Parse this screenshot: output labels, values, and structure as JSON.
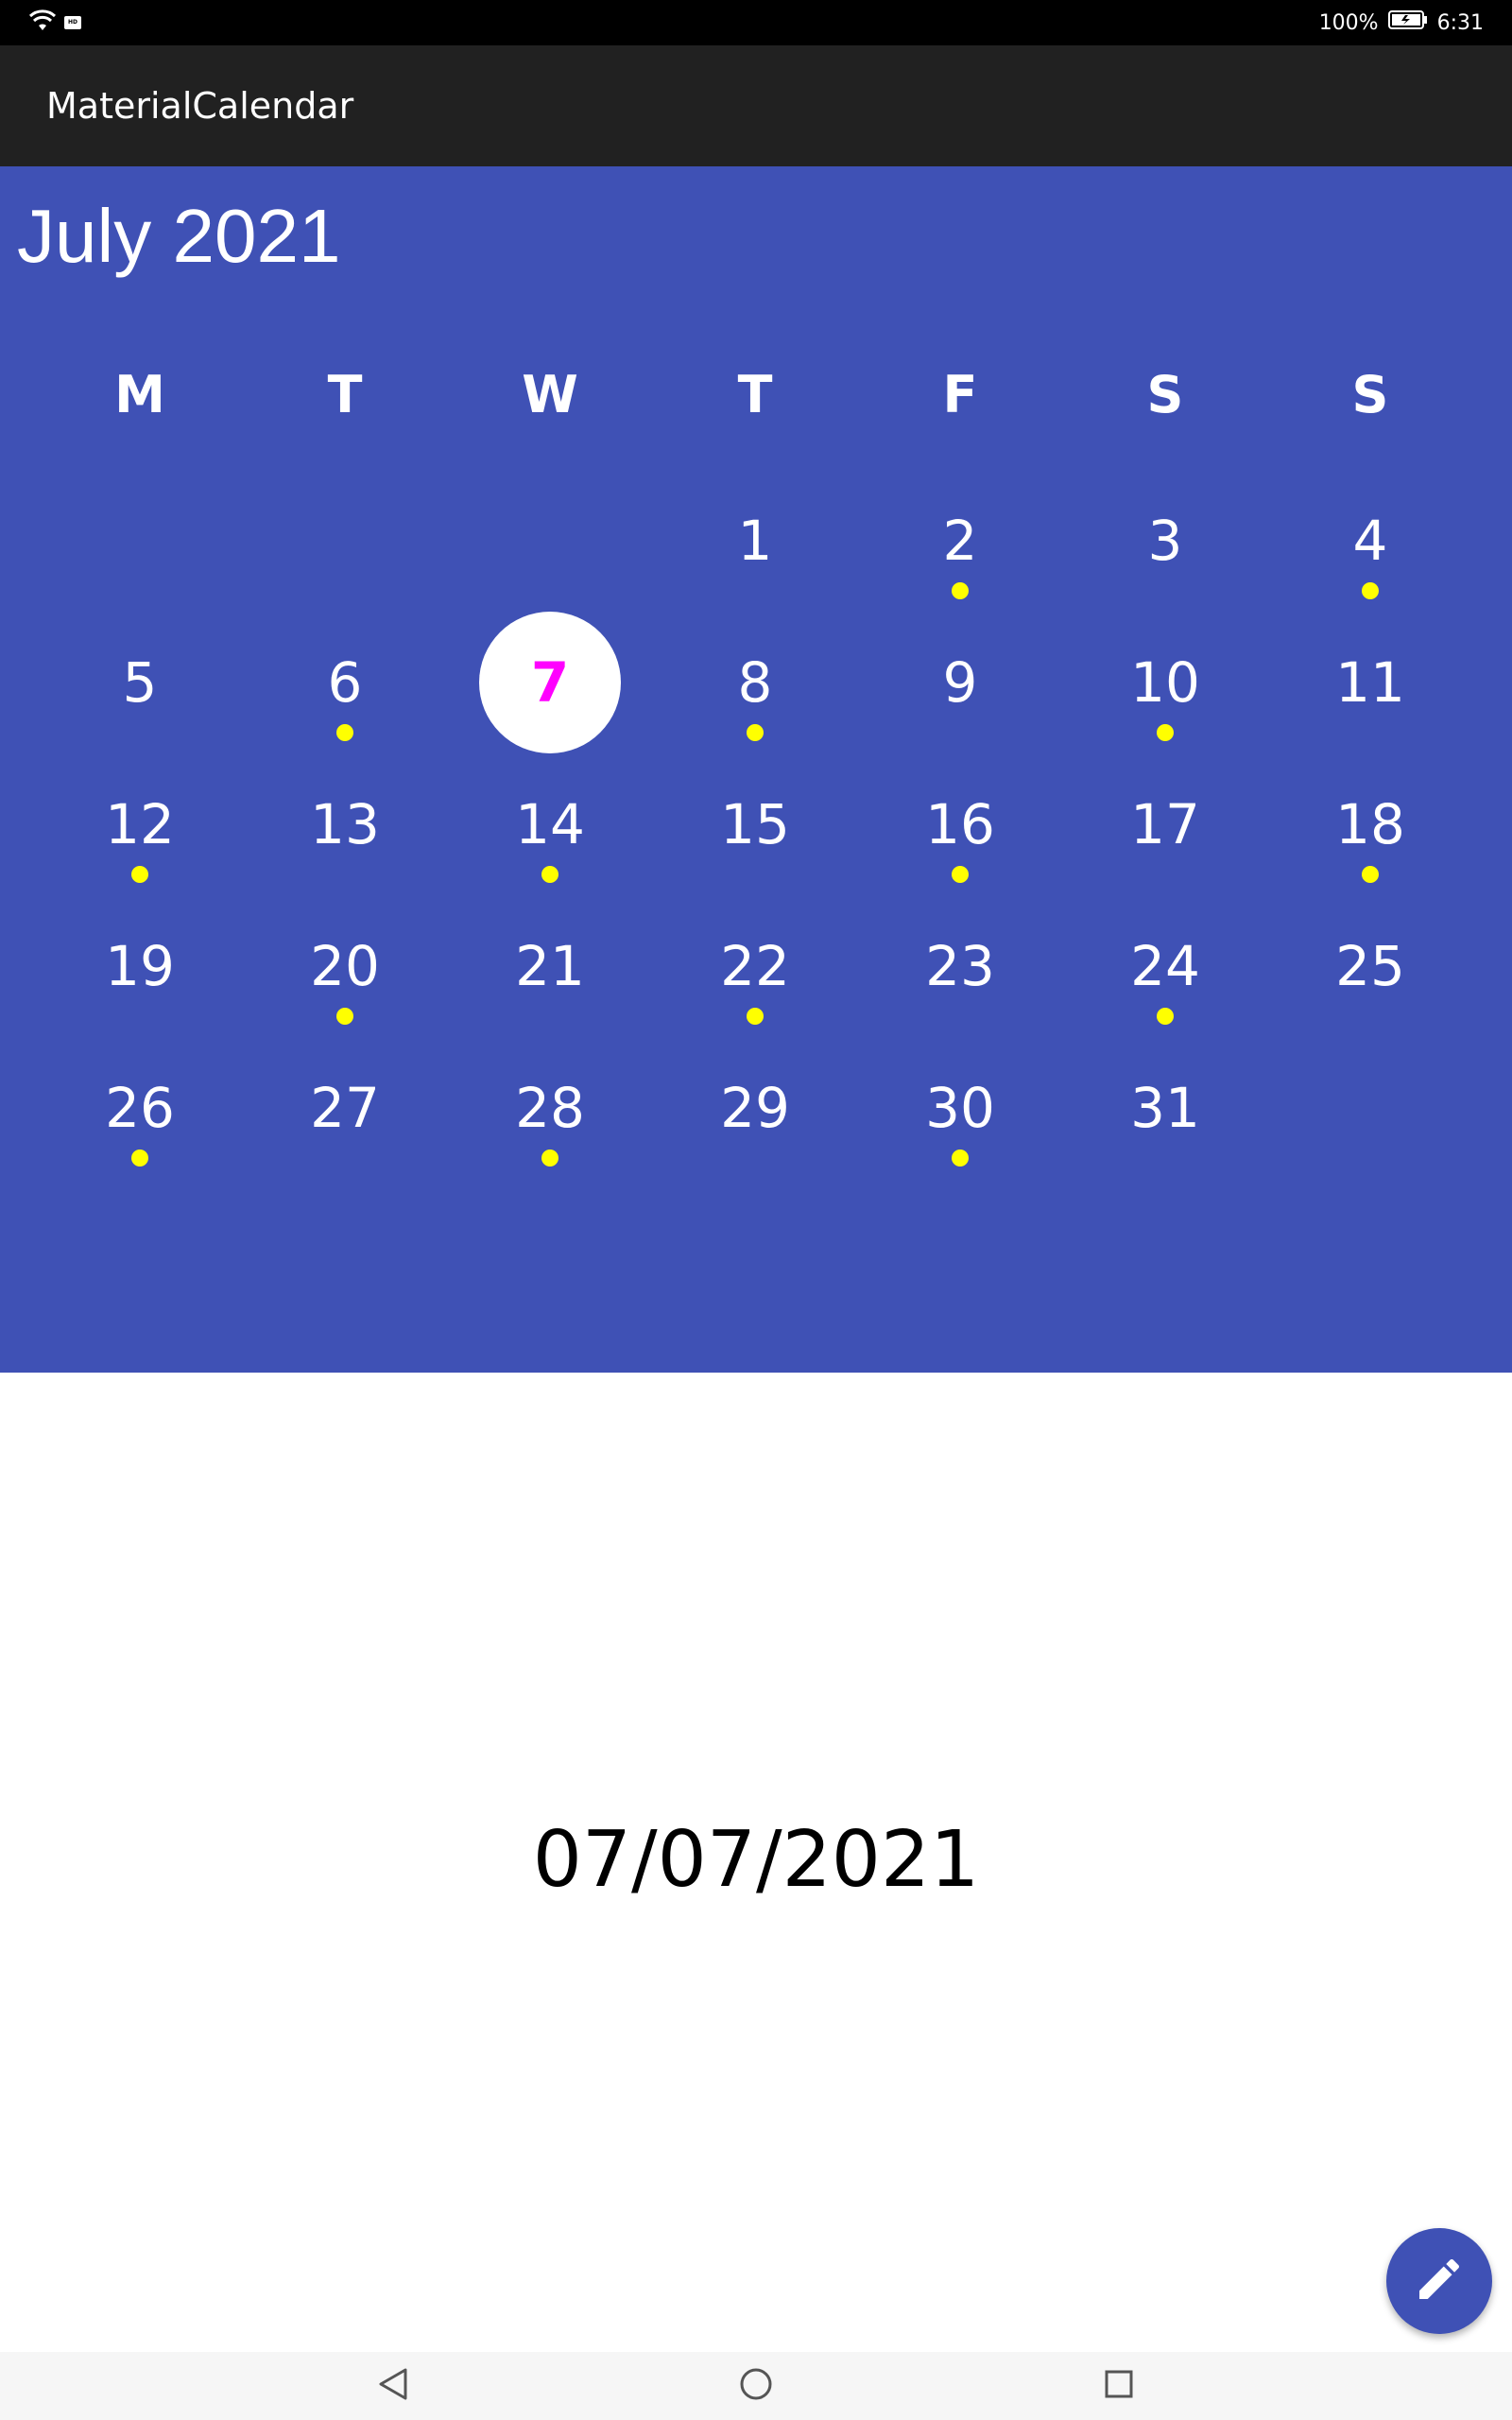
{
  "status_bar": {
    "battery": "100%",
    "time": "6:31",
    "icons": [
      "wifi-icon",
      "hd-icon",
      "battery-icon"
    ]
  },
  "toolbar": {
    "title": "MaterialCalendar"
  },
  "calendar": {
    "month_title": "July 2021",
    "weekdays": [
      "M",
      "T",
      "W",
      "T",
      "F",
      "S",
      "S"
    ],
    "selected_day": "7",
    "days": [
      {
        "day": "1",
        "event": false
      },
      {
        "day": "2",
        "event": true
      },
      {
        "day": "3",
        "event": false
      },
      {
        "day": "4",
        "event": true
      },
      {
        "day": "5",
        "event": false
      },
      {
        "day": "6",
        "event": true
      },
      {
        "day": "7",
        "event": false
      },
      {
        "day": "8",
        "event": true
      },
      {
        "day": "9",
        "event": false
      },
      {
        "day": "10",
        "event": true
      },
      {
        "day": "11",
        "event": false
      },
      {
        "day": "12",
        "event": true
      },
      {
        "day": "13",
        "event": false
      },
      {
        "day": "14",
        "event": true
      },
      {
        "day": "15",
        "event": false
      },
      {
        "day": "16",
        "event": true
      },
      {
        "day": "17",
        "event": false
      },
      {
        "day": "18",
        "event": true
      },
      {
        "day": "19",
        "event": false
      },
      {
        "day": "20",
        "event": true
      },
      {
        "day": "21",
        "event": false
      },
      {
        "day": "22",
        "event": true
      },
      {
        "day": "23",
        "event": false
      },
      {
        "day": "24",
        "event": true
      },
      {
        "day": "25",
        "event": false
      },
      {
        "day": "26",
        "event": true
      },
      {
        "day": "27",
        "event": false
      },
      {
        "day": "28",
        "event": true
      },
      {
        "day": "29",
        "event": false
      },
      {
        "day": "30",
        "event": true
      },
      {
        "day": "31",
        "event": false
      }
    ],
    "colors": {
      "background": "#3F51B5",
      "event_dot": "#FFFF00",
      "selected_text": "#FF00FF",
      "selected_circle": "#FFFFFF"
    }
  },
  "selected_date": "07/07/2021",
  "fab": {
    "icon": "pencil-icon"
  },
  "nav_bar": {
    "icons": [
      "back-icon",
      "home-icon",
      "recents-icon"
    ]
  }
}
